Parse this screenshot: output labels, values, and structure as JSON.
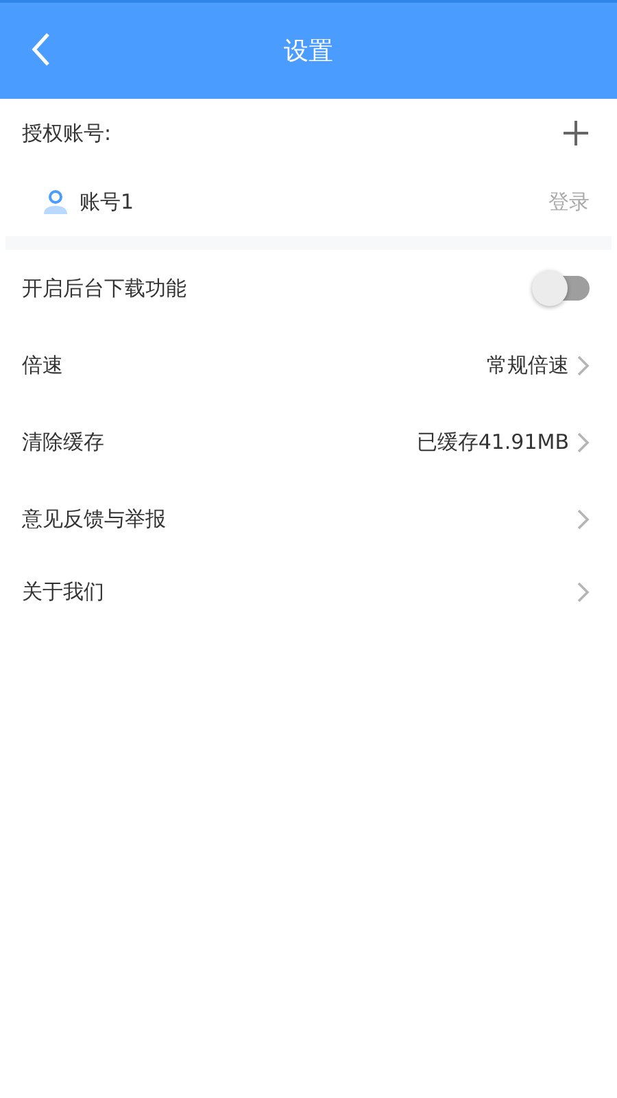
{
  "header": {
    "title": "设置"
  },
  "accounts": {
    "label": "授权账号:",
    "items": [
      {
        "name": "账号1",
        "action": "登录"
      }
    ]
  },
  "settings": [
    {
      "kind": "toggle",
      "label": "开启后台下载功能",
      "on": false
    },
    {
      "kind": "link",
      "label": "倍速",
      "value": "常规倍速"
    },
    {
      "kind": "link",
      "label": "清除缓存",
      "value": "已缓存41.91MB"
    },
    {
      "kind": "link",
      "label": "意见反馈与举报"
    },
    {
      "kind": "link",
      "label": "关于我们"
    }
  ]
}
